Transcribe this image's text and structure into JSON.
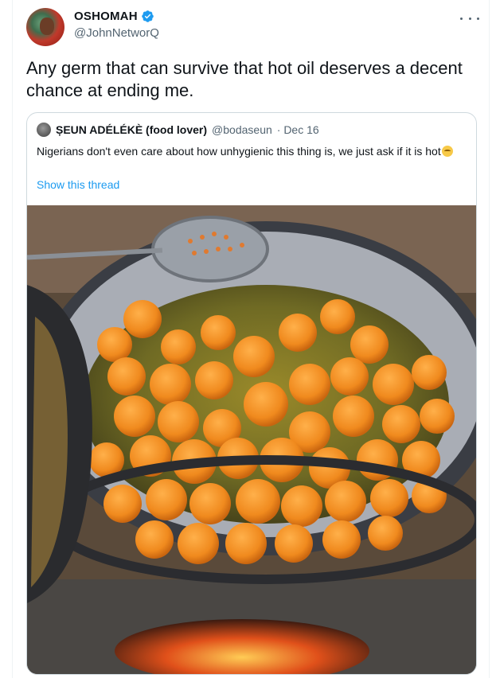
{
  "tweet": {
    "author_name": "OSHOMAH",
    "handle": "@JohnNetworQ",
    "text": "Any germ that can survive that hot oil deserves a decent chance at ending me."
  },
  "quoted": {
    "author_name": "ȘEUN ADÉLÉKÈ (food lover)",
    "handle": "@bodaseun",
    "date": "· Dec 16",
    "text": "Nigerians don't even care about how unhygienic this thing is, we just ask if it is hot",
    "link": "Show this thread",
    "image_alt": "frying akara balls in hot oil over a wood fire"
  },
  "colors": {
    "accent": "#1d9bf0",
    "text": "#0f1419",
    "muted": "#536471",
    "border": "#cfd9de"
  },
  "icons": [
    "verified-icon",
    "more-icon",
    "emoji-icon"
  ]
}
